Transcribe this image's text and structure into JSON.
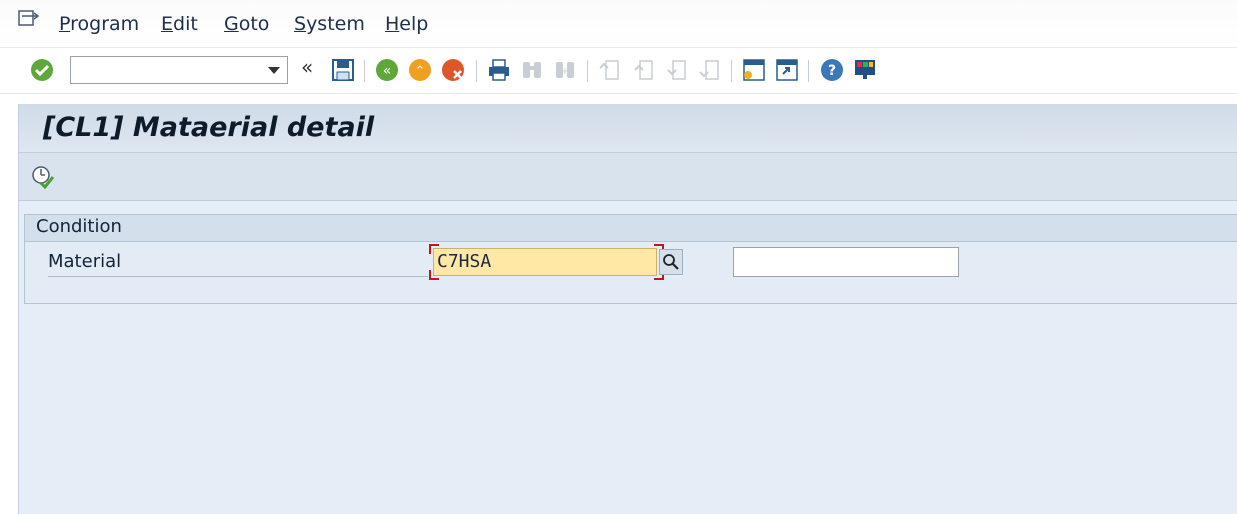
{
  "menu": {
    "items": [
      {
        "label": "Program",
        "mnemonic": "P",
        "rest": "rogram"
      },
      {
        "label": "Edit",
        "mnemonic": "E",
        "rest": "dit"
      },
      {
        "label": "Goto",
        "mnemonic": "G",
        "rest": "oto"
      },
      {
        "label": "System",
        "mnemonic": "S",
        "rest": "ystem"
      },
      {
        "label": "Help",
        "mnemonic": "H",
        "rest": "elp"
      }
    ]
  },
  "toolbar": {
    "command_field": {
      "value": ""
    },
    "icons": [
      "enter-icon",
      "command-dropdown-icon",
      "double-chevron-icon",
      "save-icon",
      "back-icon",
      "exit-icon",
      "cancel-icon",
      "print-icon",
      "find-icon",
      "find-next-icon",
      "first-page-icon",
      "previous-page-icon",
      "next-page-icon",
      "last-page-icon",
      "create-session-icon",
      "shortcut-icon",
      "help-icon",
      "customize-layout-icon"
    ]
  },
  "screen": {
    "title": "[CL1] Mataerial detail"
  },
  "condition": {
    "frame_title": "Condition",
    "material_label": "Material",
    "material_low": "C7HSA",
    "material_high": ""
  },
  "colors": {
    "accent_input": "#ffe8a6",
    "focus_bracket": "#c01818",
    "content_bg": "#e5edf6"
  }
}
